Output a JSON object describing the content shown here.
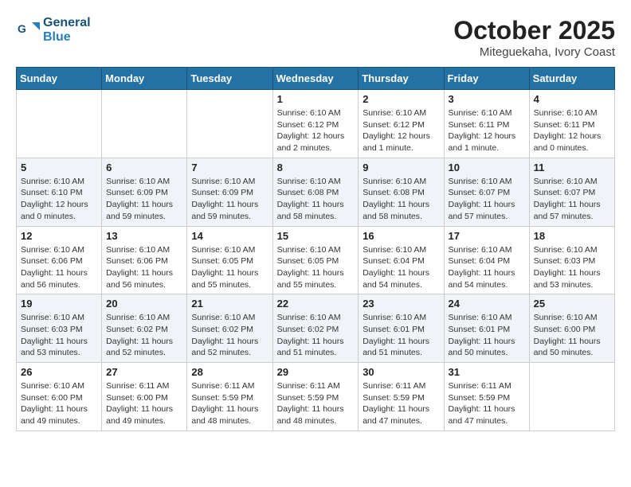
{
  "header": {
    "logo_line1": "General",
    "logo_line2": "Blue",
    "month": "October 2025",
    "location": "Miteguekaha, Ivory Coast"
  },
  "weekdays": [
    "Sunday",
    "Monday",
    "Tuesday",
    "Wednesday",
    "Thursday",
    "Friday",
    "Saturday"
  ],
  "weeks": [
    [
      {
        "day": "",
        "info": ""
      },
      {
        "day": "",
        "info": ""
      },
      {
        "day": "",
        "info": ""
      },
      {
        "day": "1",
        "info": "Sunrise: 6:10 AM\nSunset: 6:12 PM\nDaylight: 12 hours and 2 minutes."
      },
      {
        "day": "2",
        "info": "Sunrise: 6:10 AM\nSunset: 6:12 PM\nDaylight: 12 hours and 1 minute."
      },
      {
        "day": "3",
        "info": "Sunrise: 6:10 AM\nSunset: 6:11 PM\nDaylight: 12 hours and 1 minute."
      },
      {
        "day": "4",
        "info": "Sunrise: 6:10 AM\nSunset: 6:11 PM\nDaylight: 12 hours and 0 minutes."
      }
    ],
    [
      {
        "day": "5",
        "info": "Sunrise: 6:10 AM\nSunset: 6:10 PM\nDaylight: 12 hours and 0 minutes."
      },
      {
        "day": "6",
        "info": "Sunrise: 6:10 AM\nSunset: 6:09 PM\nDaylight: 11 hours and 59 minutes."
      },
      {
        "day": "7",
        "info": "Sunrise: 6:10 AM\nSunset: 6:09 PM\nDaylight: 11 hours and 59 minutes."
      },
      {
        "day": "8",
        "info": "Sunrise: 6:10 AM\nSunset: 6:08 PM\nDaylight: 11 hours and 58 minutes."
      },
      {
        "day": "9",
        "info": "Sunrise: 6:10 AM\nSunset: 6:08 PM\nDaylight: 11 hours and 58 minutes."
      },
      {
        "day": "10",
        "info": "Sunrise: 6:10 AM\nSunset: 6:07 PM\nDaylight: 11 hours and 57 minutes."
      },
      {
        "day": "11",
        "info": "Sunrise: 6:10 AM\nSunset: 6:07 PM\nDaylight: 11 hours and 57 minutes."
      }
    ],
    [
      {
        "day": "12",
        "info": "Sunrise: 6:10 AM\nSunset: 6:06 PM\nDaylight: 11 hours and 56 minutes."
      },
      {
        "day": "13",
        "info": "Sunrise: 6:10 AM\nSunset: 6:06 PM\nDaylight: 11 hours and 56 minutes."
      },
      {
        "day": "14",
        "info": "Sunrise: 6:10 AM\nSunset: 6:05 PM\nDaylight: 11 hours and 55 minutes."
      },
      {
        "day": "15",
        "info": "Sunrise: 6:10 AM\nSunset: 6:05 PM\nDaylight: 11 hours and 55 minutes."
      },
      {
        "day": "16",
        "info": "Sunrise: 6:10 AM\nSunset: 6:04 PM\nDaylight: 11 hours and 54 minutes."
      },
      {
        "day": "17",
        "info": "Sunrise: 6:10 AM\nSunset: 6:04 PM\nDaylight: 11 hours and 54 minutes."
      },
      {
        "day": "18",
        "info": "Sunrise: 6:10 AM\nSunset: 6:03 PM\nDaylight: 11 hours and 53 minutes."
      }
    ],
    [
      {
        "day": "19",
        "info": "Sunrise: 6:10 AM\nSunset: 6:03 PM\nDaylight: 11 hours and 53 minutes."
      },
      {
        "day": "20",
        "info": "Sunrise: 6:10 AM\nSunset: 6:02 PM\nDaylight: 11 hours and 52 minutes."
      },
      {
        "day": "21",
        "info": "Sunrise: 6:10 AM\nSunset: 6:02 PM\nDaylight: 11 hours and 52 minutes."
      },
      {
        "day": "22",
        "info": "Sunrise: 6:10 AM\nSunset: 6:02 PM\nDaylight: 11 hours and 51 minutes."
      },
      {
        "day": "23",
        "info": "Sunrise: 6:10 AM\nSunset: 6:01 PM\nDaylight: 11 hours and 51 minutes."
      },
      {
        "day": "24",
        "info": "Sunrise: 6:10 AM\nSunset: 6:01 PM\nDaylight: 11 hours and 50 minutes."
      },
      {
        "day": "25",
        "info": "Sunrise: 6:10 AM\nSunset: 6:00 PM\nDaylight: 11 hours and 50 minutes."
      }
    ],
    [
      {
        "day": "26",
        "info": "Sunrise: 6:10 AM\nSunset: 6:00 PM\nDaylight: 11 hours and 49 minutes."
      },
      {
        "day": "27",
        "info": "Sunrise: 6:11 AM\nSunset: 6:00 PM\nDaylight: 11 hours and 49 minutes."
      },
      {
        "day": "28",
        "info": "Sunrise: 6:11 AM\nSunset: 5:59 PM\nDaylight: 11 hours and 48 minutes."
      },
      {
        "day": "29",
        "info": "Sunrise: 6:11 AM\nSunset: 5:59 PM\nDaylight: 11 hours and 48 minutes."
      },
      {
        "day": "30",
        "info": "Sunrise: 6:11 AM\nSunset: 5:59 PM\nDaylight: 11 hours and 47 minutes."
      },
      {
        "day": "31",
        "info": "Sunrise: 6:11 AM\nSunset: 5:59 PM\nDaylight: 11 hours and 47 minutes."
      },
      {
        "day": "",
        "info": ""
      }
    ]
  ]
}
